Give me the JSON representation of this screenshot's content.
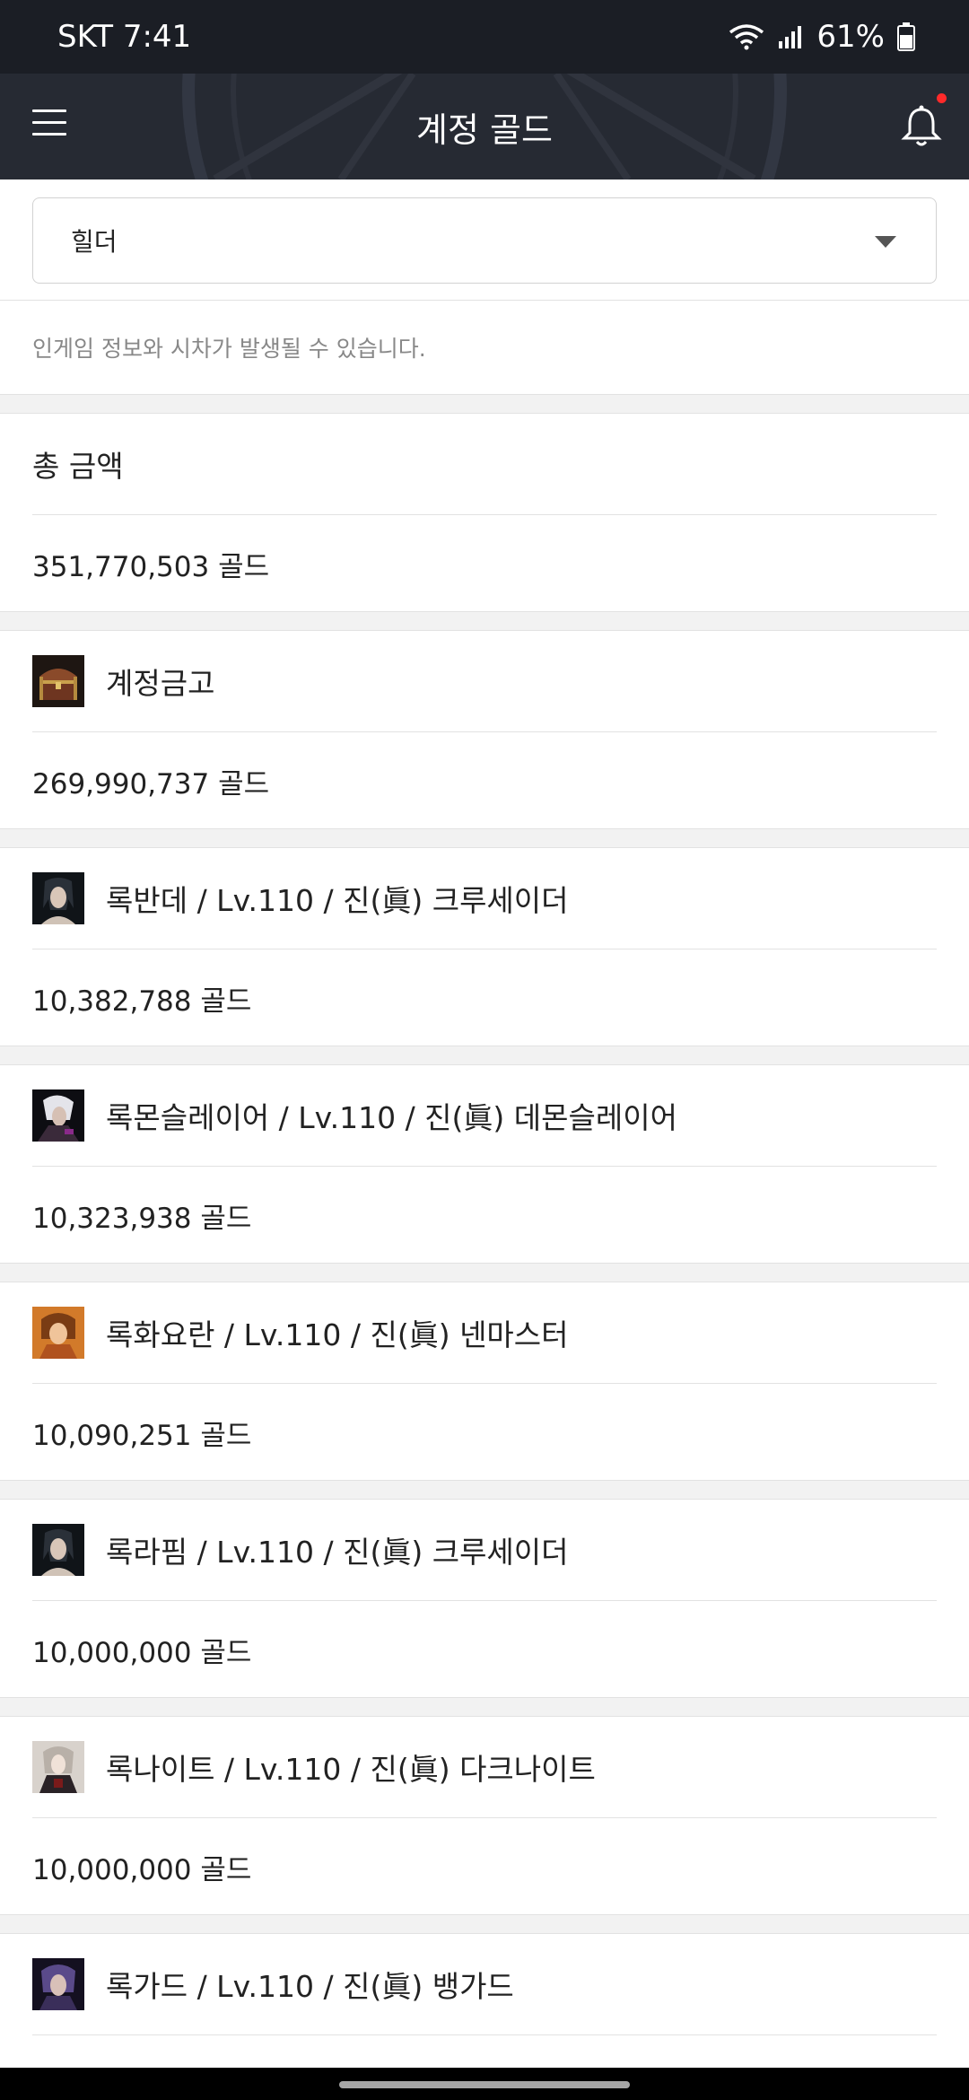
{
  "status_bar": {
    "carrier_time": "SKT 7:41",
    "battery": "61%"
  },
  "header": {
    "title": "계정 골드",
    "menu_icon": "hamburger-menu-icon",
    "bell_icon": "bell-icon",
    "accent": "#ff2a2a"
  },
  "server_select": {
    "value": "힐더"
  },
  "notice": "인게임 정보와 시차가 발생될 수 있습니다.",
  "total": {
    "label": "총 금액",
    "amount": "351,770,503 골드"
  },
  "vault": {
    "label": "계정금고",
    "amount": "269,990,737 골드",
    "icon": "treasure-chest-icon"
  },
  "characters": [
    {
      "label": "록반데 / Lv.110 / 진(眞) 크루세이더",
      "amount": "10,382,788 골드"
    },
    {
      "label": "록몬슬레이어 / Lv.110 / 진(眞) 데몬슬레이어",
      "amount": "10,323,938 골드"
    },
    {
      "label": "록화요란 / Lv.110 / 진(眞) 넨마스터",
      "amount": "10,090,251 골드"
    },
    {
      "label": "록라핌 / Lv.110 / 진(眞) 크루세이더",
      "amount": "10,000,000 골드"
    },
    {
      "label": "록나이트 / Lv.110 / 진(眞) 다크나이트",
      "amount": "10,000,000 골드"
    },
    {
      "label": "록가드 / Lv.110 / 진(眞) 뱅가드",
      "amount": ""
    }
  ]
}
